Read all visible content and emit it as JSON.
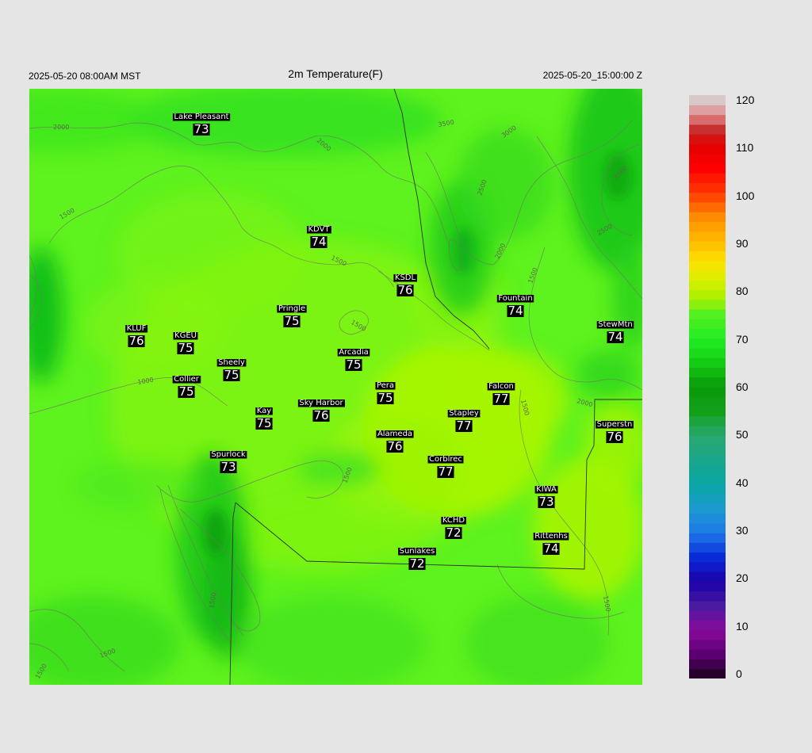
{
  "header": {
    "valid_local": "2025-05-20 08:00AM MST",
    "title": "2m Temperature(F)",
    "valid_utc": "2025-05-20_15:00:00 Z"
  },
  "colorbar": {
    "ticks": [
      "120",
      "110",
      "100",
      "90",
      "80",
      "70",
      "60",
      "50",
      "40",
      "30",
      "20",
      "10",
      "0"
    ],
    "min": 0,
    "max": 120,
    "colors": {
      "0": "#1a001a",
      "5": "#5a0070",
      "10": "#8a0a9a",
      "15": "#4a1aa0",
      "20": "#1a00a8",
      "25": "#0a2ad8",
      "30": "#1e78e8",
      "35": "#1c9ad0",
      "40": "#0aa6a6",
      "45": "#1aa68a",
      "50": "#28a870",
      "55": "#12a01a",
      "60": "#0a9a0a",
      "65": "#14cc14",
      "70": "#22ee22",
      "75": "#55f020",
      "78": "#a6f000",
      "82": "#d8f000",
      "86": "#ffe000",
      "90": "#ffbb00",
      "95": "#ff8c00",
      "100": "#ff3a00",
      "105": "#ff0000",
      "110": "#e00000",
      "113": "#c83030",
      "116": "#e08a8a",
      "119": "#d8c8c8",
      "120": "#cccccc"
    }
  },
  "stations": [
    {
      "name": "Lake Pleasant",
      "value": "73"
    },
    {
      "name": "KDVT",
      "value": "74"
    },
    {
      "name": "KSDL",
      "value": "76"
    },
    {
      "name": "Fountain",
      "value": "74"
    },
    {
      "name": "StewMtn",
      "value": "74"
    },
    {
      "name": "KLUF",
      "value": "76"
    },
    {
      "name": "KGEU",
      "value": "75"
    },
    {
      "name": "Pringle",
      "value": "75"
    },
    {
      "name": "Sheely",
      "value": "75"
    },
    {
      "name": "Collier",
      "value": "75"
    },
    {
      "name": "Arcadia",
      "value": "75"
    },
    {
      "name": "Pera",
      "value": "75"
    },
    {
      "name": "Falcon",
      "value": "77"
    },
    {
      "name": "Kay",
      "value": "75"
    },
    {
      "name": "Sky Harbor",
      "value": "76"
    },
    {
      "name": "Stapley",
      "value": "77"
    },
    {
      "name": "Superstn",
      "value": "76"
    },
    {
      "name": "Alameda",
      "value": "76"
    },
    {
      "name": "Spurlock",
      "value": "73"
    },
    {
      "name": "Corblrec",
      "value": "77"
    },
    {
      "name": "KIWA",
      "value": "73"
    },
    {
      "name": "KCHD",
      "value": "72"
    },
    {
      "name": "Rittenhs",
      "value": "74"
    },
    {
      "name": "Sunlakes",
      "value": "72"
    }
  ],
  "contour_labels": [
    "2000",
    "2000",
    "3500",
    "3000",
    "3500",
    "2500",
    "2500",
    "2000",
    "1500",
    "1500",
    "1500",
    "1500",
    "1000",
    "1500",
    "2000",
    "1500",
    "1500",
    "1500",
    "1500",
    "1500"
  ]
}
